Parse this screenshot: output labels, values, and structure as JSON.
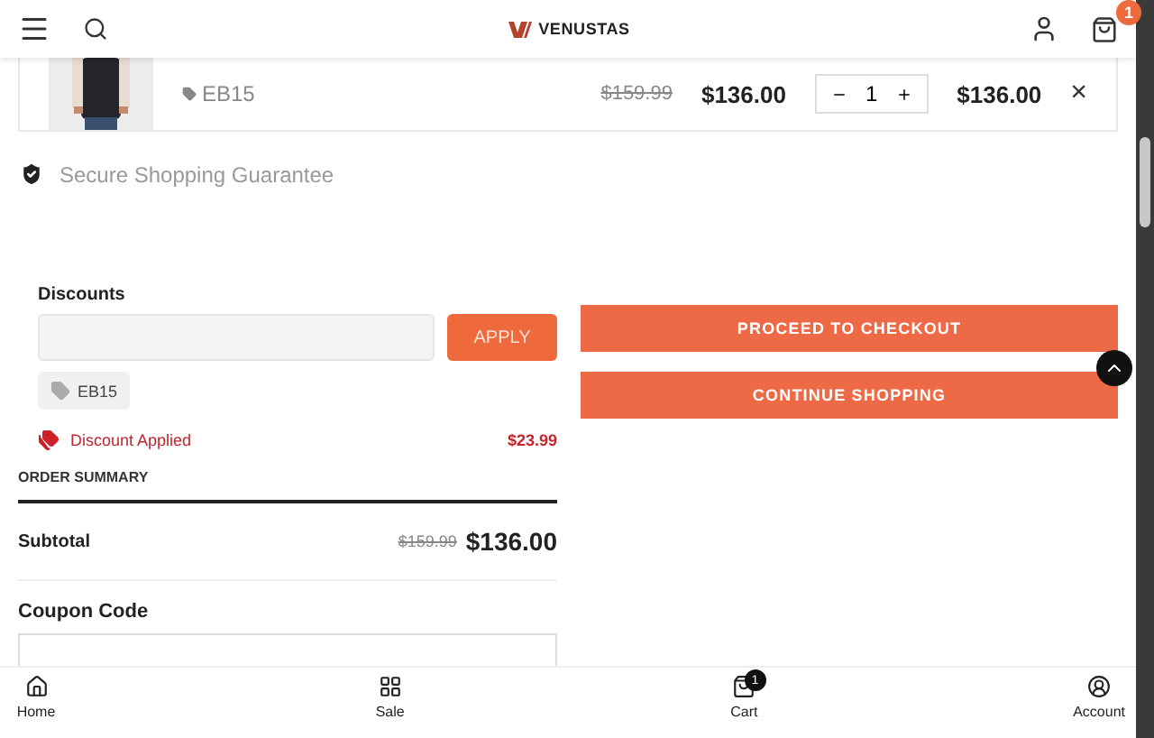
{
  "header": {
    "brand": "VENUSTAS",
    "cart_count": "1"
  },
  "cart_item": {
    "kind": "picture",
    "code": "EB15",
    "old_price": "$159.99",
    "price": "$136.00",
    "quantity": "1",
    "total": "$136.00",
    "remove": "×"
  },
  "guarantee": "Secure Shopping Guarantee",
  "discounts": {
    "label": "Discounts",
    "apply": "APPLY",
    "codes": [
      "EB15"
    ],
    "applied_label": "Discount Applied",
    "applied_amount": "$23.99"
  },
  "order_summary": {
    "title": "ORDER SUMMARY",
    "subtotal_label": "Subtotal",
    "subtotal_old": "$159.99",
    "subtotal": "$136.00",
    "coupon_label": "Coupon Code"
  },
  "buttons": [
    "PROCEED TO CHECKOUT",
    "CONTINUE SHOPPING"
  ],
  "bottom_nav": [
    {
      "label": "Home",
      "kind": "home"
    },
    {
      "label": "Sale",
      "kind": "grid"
    },
    {
      "label": "Cart",
      "kind": "bag",
      "badge": "1"
    },
    {
      "label": "Account",
      "kind": "user"
    }
  ]
}
